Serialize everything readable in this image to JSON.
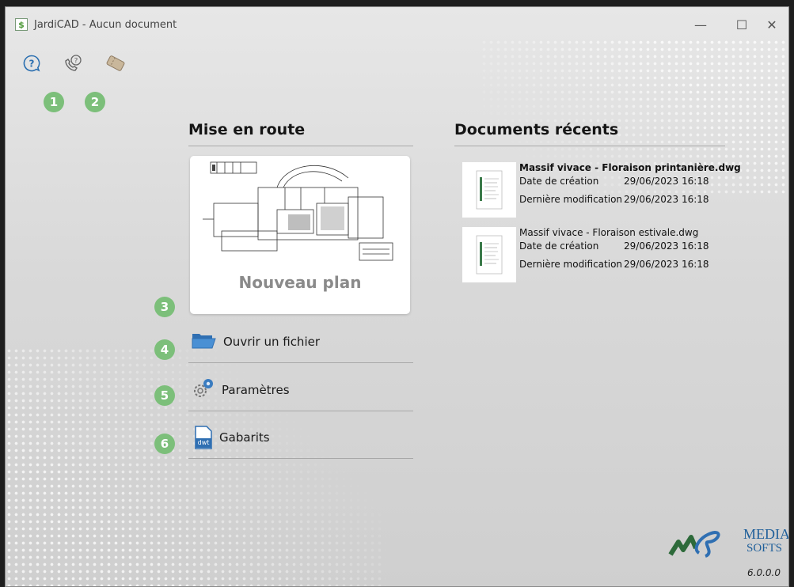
{
  "window": {
    "title": "JardiCAD - Aucun document",
    "controls": {
      "minimize": "—",
      "maximize": "☐",
      "close": "✕"
    }
  },
  "toolbar": {
    "icons": [
      "help-icon",
      "support-phone-icon",
      "ticket-icon"
    ]
  },
  "badges": [
    "1",
    "2",
    "3",
    "4",
    "5",
    "6"
  ],
  "getting_started": {
    "title": "Mise en route",
    "new_plan_label": "Nouveau plan",
    "open_file_label": "Ouvrir un fichier",
    "settings_label": "Paramètres",
    "templates_label": "Gabarits",
    "templates_icon_text": "dwt"
  },
  "recent": {
    "title": "Documents récents",
    "documents": [
      {
        "name": "Massif vivace - Floraison printanière.dwg",
        "created_label": "Date de création",
        "created": "29/06/2023 16:18",
        "modified_label": "Dernière modification",
        "modified": "29/06/2023 16:18"
      },
      {
        "name": "Massif vivace - Floraison estivale.dwg",
        "created_label": "Date de création",
        "created": "29/06/2023 16:18",
        "modified_label": "Dernière modification",
        "modified": "29/06/2023 16:18"
      }
    ]
  },
  "brand": {
    "logo_text_1": "MEDIA",
    "logo_text_2": "SOFTS",
    "version": "6.0.0.0",
    "accent_color": "#7cbf7a"
  }
}
